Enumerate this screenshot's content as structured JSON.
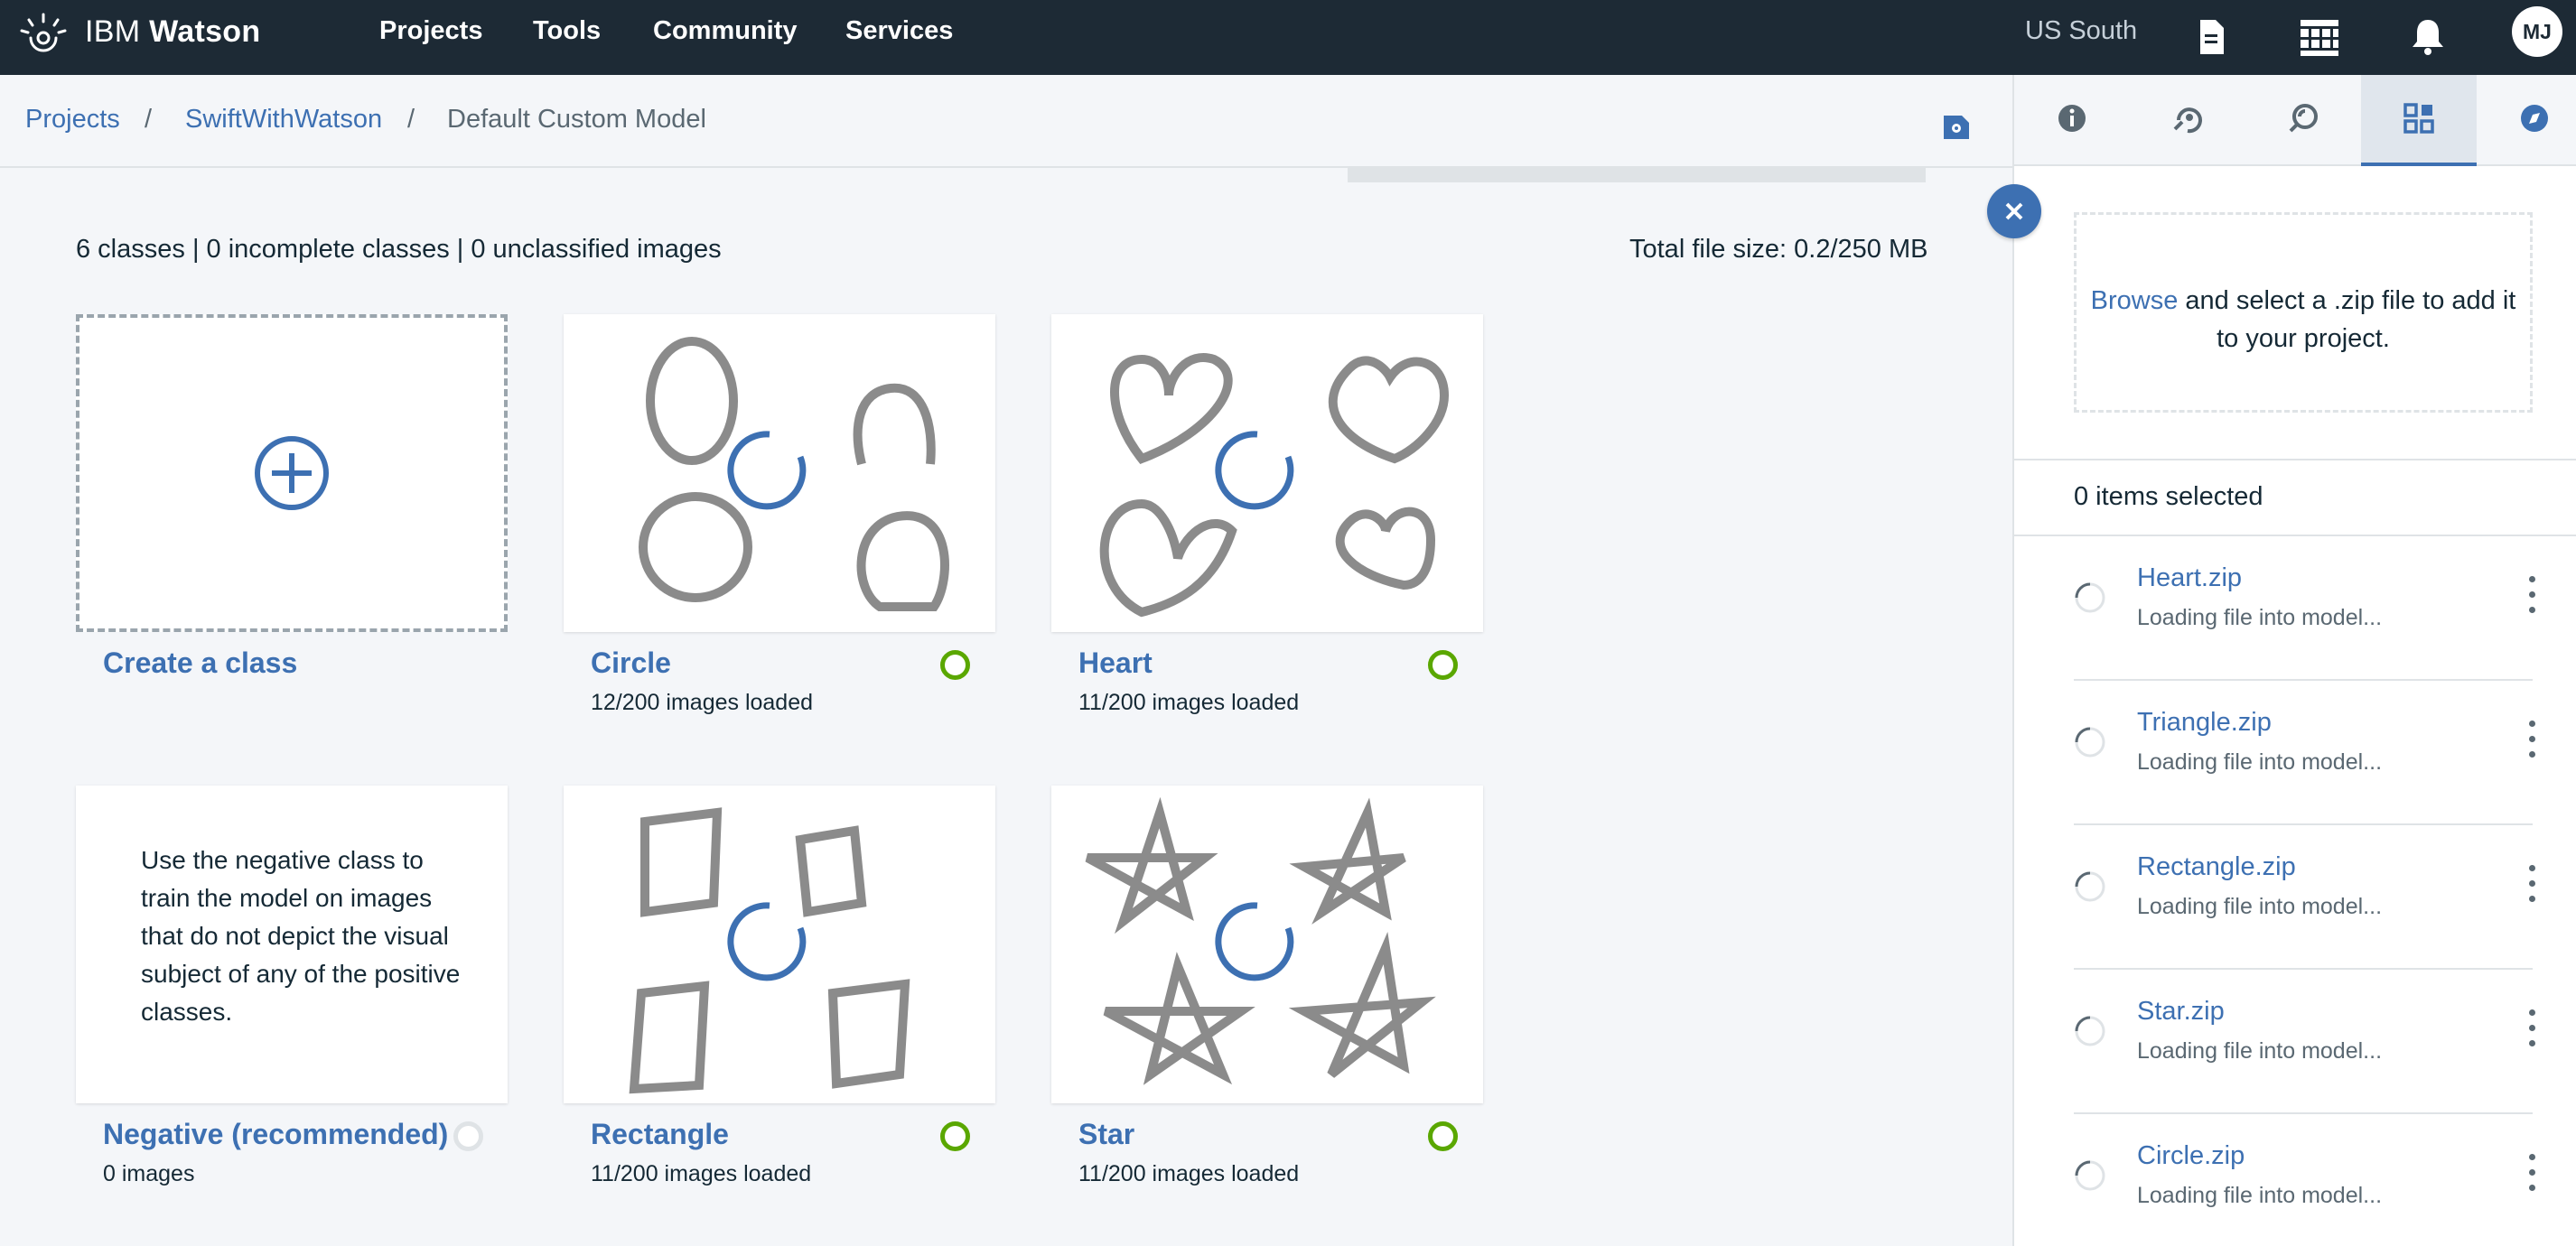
{
  "header": {
    "brand_prefix": "IBM",
    "brand_name": "Watson",
    "nav": [
      "Projects",
      "Tools",
      "Community",
      "Services"
    ],
    "region": "US South",
    "avatar_initials": "MJ",
    "icons": [
      "document-icon",
      "apps-grid-icon",
      "bell-icon"
    ]
  },
  "breadcrumb": {
    "items": [
      "Projects",
      "SwiftWithWatson",
      "Default Custom Model"
    ],
    "separator": "/"
  },
  "summary": {
    "counts": "6 classes | 0 incomplete classes | 0 unclassified images",
    "file_size": "Total file size: 0.2/250 MB"
  },
  "classes": [
    {
      "title": "Create a class",
      "subtitle": "",
      "type": "create"
    },
    {
      "title": "Circle",
      "subtitle": "12/200 images loaded",
      "status": "complete",
      "shape": "circle"
    },
    {
      "title": "Heart",
      "subtitle": "11/200 images loaded",
      "status": "complete",
      "shape": "heart"
    },
    {
      "title": "Negative (recommended)",
      "subtitle": "0 images",
      "status": "empty",
      "description": "Use the negative class to train the model on images that do not depict the visual subject of any of the positive classes."
    },
    {
      "title": "Rectangle",
      "subtitle": "11/200 images loaded",
      "status": "complete",
      "shape": "rectangle"
    },
    {
      "title": "Star",
      "subtitle": "11/200 images loaded",
      "status": "complete",
      "shape": "star"
    }
  ],
  "status_colors": {
    "complete": "#5aa700",
    "empty": "#dfe3e6",
    "accent": "#3d70b2"
  },
  "panel": {
    "tabs": [
      "info-icon",
      "train-icon",
      "test-icon",
      "assets-icon",
      "compass-icon"
    ],
    "active_tab": "assets-icon",
    "dropzone_link": "Browse",
    "dropzone_text": "and select a .zip file to add it to your project.",
    "selected_text": "0 items selected",
    "files": [
      {
        "name": "Heart.zip",
        "status": "Loading file into model..."
      },
      {
        "name": "Triangle.zip",
        "status": "Loading file into model..."
      },
      {
        "name": "Rectangle.zip",
        "status": "Loading file into model..."
      },
      {
        "name": "Star.zip",
        "status": "Loading file into model..."
      },
      {
        "name": "Circle.zip",
        "status": "Loading file into model..."
      }
    ]
  }
}
